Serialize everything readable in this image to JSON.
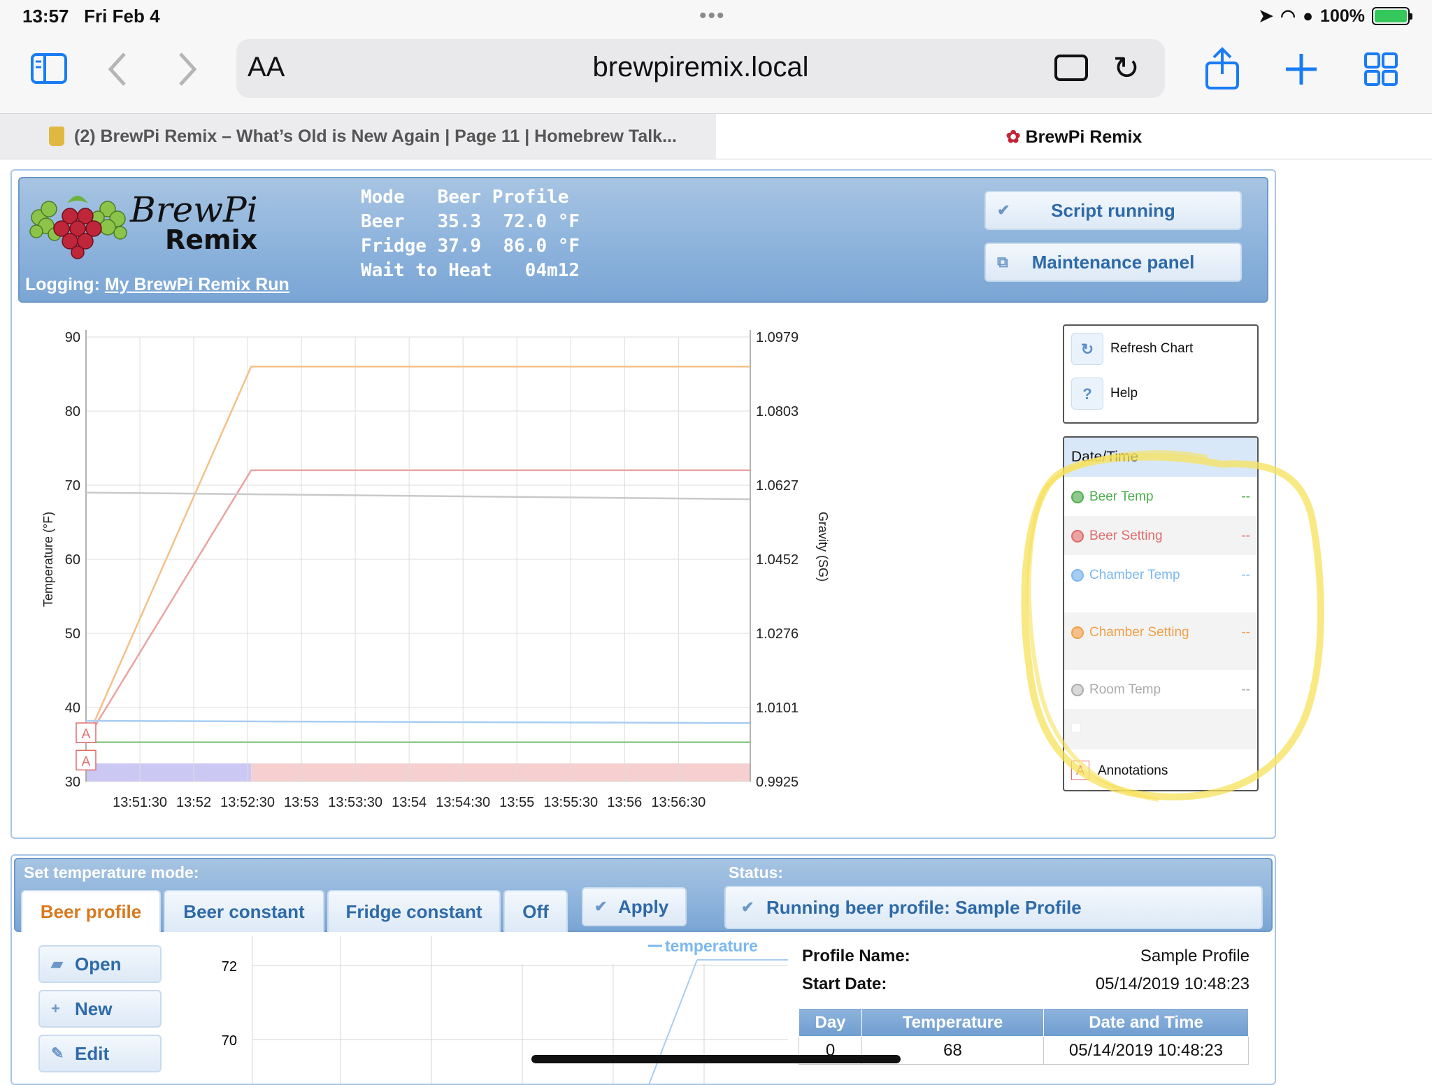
{
  "status_bar": {
    "time": "13:57",
    "date": "Fri Feb 4",
    "battery": "100%"
  },
  "toolbar": {
    "aa_label": "AA",
    "url": "brewpiremix.local"
  },
  "tabs": [
    {
      "title": "(2) BrewPi Remix – What’s Old is New Again | Page 11 | Homebrew Talk..."
    },
    {
      "title": "BrewPi Remix"
    }
  ],
  "header": {
    "logo_text_1": "BrewPi",
    "logo_text_2": "Remix",
    "logging_label": "Logging:",
    "logging_link": "My BrewPi Remix Run",
    "lcd_lines": [
      "Mode   Beer Profile",
      "Beer   35.3  72.0 °F",
      "Fridge 37.9  86.0 °F",
      "Wait to Heat   04m12"
    ],
    "script_button": "Script running",
    "maintenance_button": "Maintenance panel"
  },
  "chart_controls": {
    "refresh": "Refresh Chart",
    "help": "Help"
  },
  "legend": {
    "header": "Date/Time",
    "items": [
      {
        "name": "Beer Temp",
        "value": "--",
        "color": "#4cae4c"
      },
      {
        "name": "Beer Setting",
        "value": "--",
        "color": "#e06b6b"
      },
      {
        "name": "Chamber Temp",
        "value": "--",
        "color": "#7ab8ef"
      },
      {
        "name": "Chamber Setting",
        "value": "--",
        "color": "#f0a14a"
      },
      {
        "name": "Room Temp",
        "value": "--",
        "color": "#aaaaaa"
      }
    ],
    "annotations": "Annotations",
    "annotation_marker": "A"
  },
  "chart_data": {
    "type": "line",
    "ylabel": "Temperature (°F)",
    "y2label": "Gravity (SG)",
    "ylim": [
      30,
      90
    ],
    "y_ticks": [
      30,
      40,
      50,
      60,
      70,
      80,
      90
    ],
    "y2_ticks": [
      "0.9925",
      "1.0101",
      "1.0276",
      "1.0452",
      "1.0627",
      "1.0803",
      "1.0979"
    ],
    "x_ticks": [
      "13:51:30",
      "13:52",
      "13:52:30",
      "13:53",
      "13:53:30",
      "13:54",
      "13:54:30",
      "13:55",
      "13:55:30",
      "13:56",
      "13:56:30"
    ],
    "x_range_sec": [
      0,
      370
    ],
    "series": [
      {
        "name": "Chamber Setting",
        "color": "#f5c08a",
        "points": [
          [
            0,
            35.5
          ],
          [
            92,
            86.0
          ],
          [
            370,
            86.0
          ]
        ]
      },
      {
        "name": "Beer Setting",
        "color": "#eba3a3",
        "points": [
          [
            0,
            35.5
          ],
          [
            92,
            72.0
          ],
          [
            370,
            72.0
          ]
        ]
      },
      {
        "name": "Room Temp",
        "color": "#c9c9c9",
        "points": [
          [
            0,
            69.0
          ],
          [
            370,
            68.1
          ]
        ]
      },
      {
        "name": "Chamber Temp",
        "color": "#a8cdf2",
        "points": [
          [
            0,
            38.2
          ],
          [
            370,
            37.9
          ]
        ]
      },
      {
        "name": "Beer Temp",
        "color": "#8fc98f",
        "points": [
          [
            0,
            35.3
          ],
          [
            370,
            35.3
          ]
        ]
      }
    ],
    "state_bands": [
      {
        "from": 0,
        "to": 92,
        "color": "#cbc9f4"
      },
      {
        "from": 92,
        "to": 370,
        "color": "#f6d0d0"
      }
    ],
    "annotations": [
      {
        "label": "A",
        "y": 36.5
      },
      {
        "label": "A",
        "y": 32.8
      }
    ]
  },
  "control_panel": {
    "set_mode_label": "Set temperature mode:",
    "status_label": "Status:",
    "modes": [
      "Beer profile",
      "Beer constant",
      "Fridge constant",
      "Off"
    ],
    "active_mode": 0,
    "apply": "Apply",
    "status_text": "Running beer profile: Sample Profile",
    "side_buttons": [
      "Open",
      "New",
      "Edit"
    ],
    "profile_chart": {
      "legend": "temperature",
      "y_ticks": [
        72,
        70
      ]
    },
    "profile_name_label": "Profile Name:",
    "profile_name": "Sample Profile",
    "start_date_label": "Start Date:",
    "start_date": "05/14/2019 10:48:23",
    "table_headers": [
      "Day",
      "Temperature",
      "Date and Time"
    ],
    "table_rows": [
      [
        "0",
        "68",
        "05/14/2019 10:48:23"
      ]
    ]
  }
}
